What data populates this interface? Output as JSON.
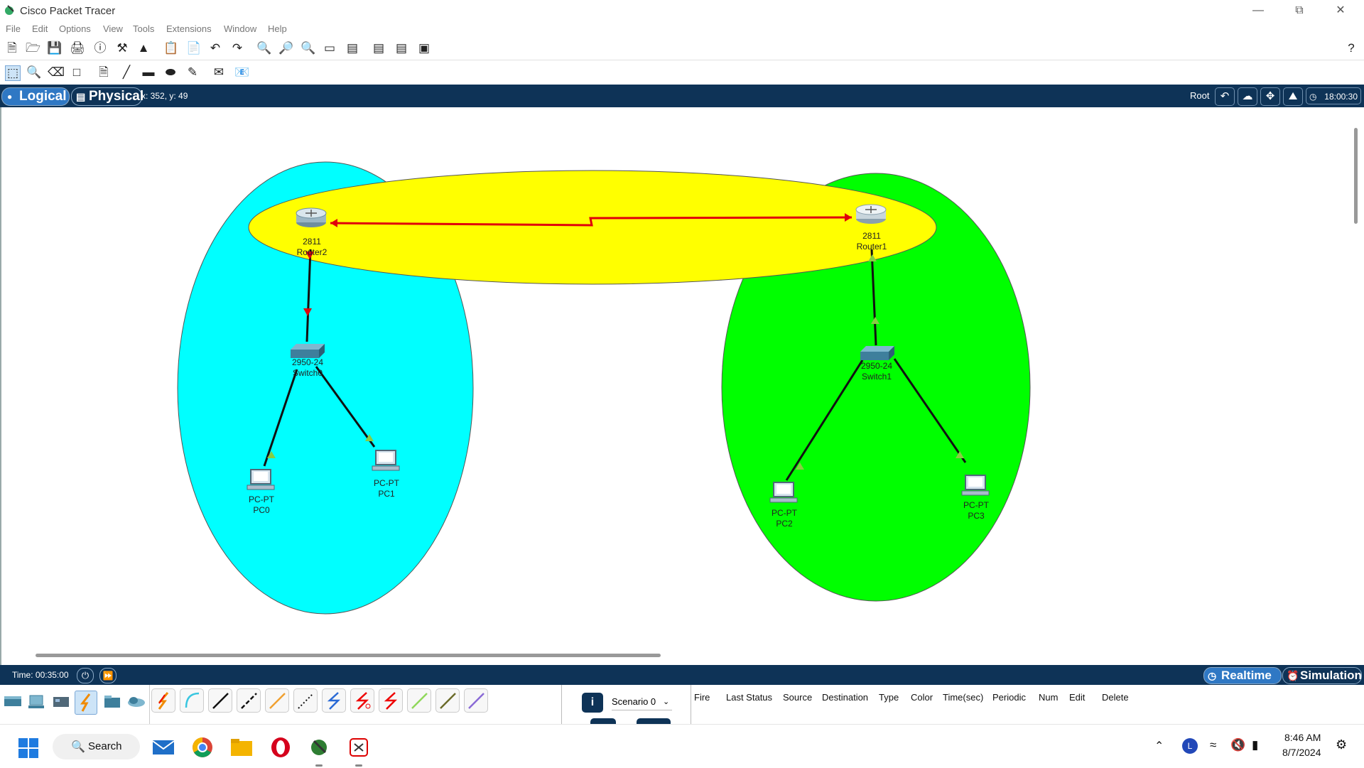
{
  "window": {
    "title": "Cisco Packet Tracer"
  },
  "menu": [
    "File",
    "Edit",
    "Options",
    "View",
    "Tools",
    "Extensions",
    "Window",
    "Help"
  ],
  "viewbar": {
    "logical_label": "Logical",
    "physical_label": "Physical",
    "coords": "x: 352, y: 49",
    "root_label": "Root",
    "clock": "18:00:30"
  },
  "devices": {
    "router2": {
      "model": "2811",
      "name": "Router2"
    },
    "router1": {
      "model": "2811",
      "name": "Router1"
    },
    "switch0": {
      "model": "2950-24",
      "name": "Switch0"
    },
    "switch1": {
      "model": "2950-24",
      "name": "Switch1"
    },
    "pc0": {
      "model": "PC-PT",
      "name": "PC0"
    },
    "pc1": {
      "model": "PC-PT",
      "name": "PC1"
    },
    "pc2": {
      "model": "PC-PT",
      "name": "PC2"
    },
    "pc3": {
      "model": "PC-PT",
      "name": "PC3"
    }
  },
  "colors": {
    "lan1_area": "#00ffff",
    "lan2_area": "#00ff00",
    "wan_area": "#ffff00",
    "serial_link": "#e0000b",
    "bar": "#0e3357"
  },
  "timebar": {
    "time": "Time: 00:35:00",
    "realtime_label": "Realtime",
    "simulation_label": "Simulation"
  },
  "scenario": {
    "selected": "Scenario 0"
  },
  "pdu_columns": [
    "Fire",
    "Last Status",
    "Source",
    "Destination",
    "Type",
    "Color",
    "Time(sec)",
    "Periodic",
    "Num",
    "Edit",
    "Delete"
  ],
  "taskbar": {
    "search_label": "Search",
    "time": "8:46 AM",
    "date": "8/7/2024"
  }
}
